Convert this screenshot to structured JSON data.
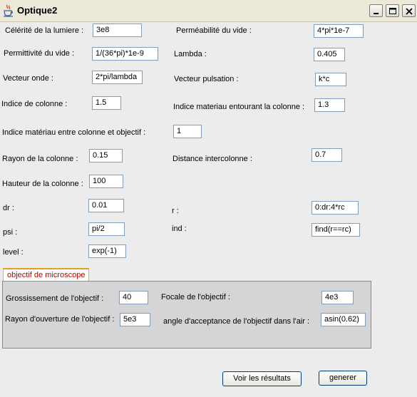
{
  "window": {
    "title": "Optique2"
  },
  "fields": {
    "celerite": {
      "label": "Célérité de la lumiere :",
      "value": "3e8"
    },
    "permeabilite": {
      "label": "Perméabilité du vide :",
      "value": "4*pi*1e-7"
    },
    "permittivite": {
      "label": "Permittivité du vide :",
      "value": "1/(36*pi)*1e-9"
    },
    "lambda": {
      "label": "Lambda :",
      "value": "0.405"
    },
    "vecteur_onde": {
      "label": "Vecteur onde :",
      "value": "2*pi/lambda"
    },
    "vecteur_pulsation": {
      "label": "Vecteur pulsation :",
      "value": "k*c"
    },
    "indice_colonne": {
      "label": "Indice de colonne :",
      "value": "1.5"
    },
    "indice_entourant": {
      "label": "Indice materiau entourant la colonne :",
      "value": "1.3"
    },
    "indice_entre": {
      "label": "Indice matériau entre colonne et objectif :",
      "value": "1"
    },
    "rayon_colonne": {
      "label": "Rayon de la colonne :",
      "value": "0.15"
    },
    "distance_intercolonne": {
      "label": "Distance intercolonne :",
      "value": "0.7"
    },
    "hauteur_colonne": {
      "label": "Hauteur de la colonne :",
      "value": "100"
    },
    "dr": {
      "label": "dr :",
      "value": "0.01"
    },
    "r": {
      "label": "r :",
      "value": "0:dr:4*rc"
    },
    "psi": {
      "label": "psi :",
      "value": "pi/2"
    },
    "ind": {
      "label": "ind :",
      "value": "find(r==rc)"
    },
    "level": {
      "label": "level :",
      "value": "exp(-1)"
    }
  },
  "tab": {
    "label": "objectif de microscope"
  },
  "objectif": {
    "grossissement": {
      "label": "Grossissement de l'objectif :",
      "value": "40"
    },
    "focale": {
      "label": "Focale de l'objectif :",
      "value": "4e3"
    },
    "rayon_ouverture": {
      "label": "Rayon d'ouverture de l'objectif :",
      "value": "5e3"
    },
    "angle_acceptance": {
      "label": "angle d'acceptance de l'objectif dans l'air :",
      "value": "asin(0.62)"
    }
  },
  "buttons": {
    "voir": "Voir les résultats",
    "generer": "generer"
  },
  "icons": {
    "app": "java-cup-icon",
    "minimize": "minimize-icon",
    "maximize": "maximize-icon",
    "close": "close-icon"
  },
  "colors": {
    "tab_text": "#c00000",
    "tab_accent": "#e3a21a",
    "close_button": "#d8492b"
  }
}
